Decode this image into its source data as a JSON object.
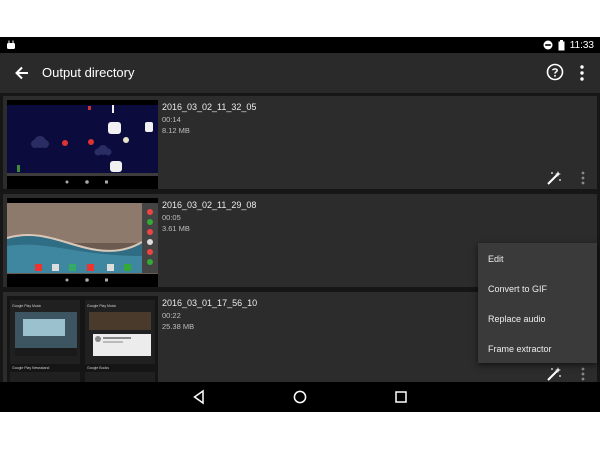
{
  "status_bar": {
    "time": "11:33",
    "icons": [
      "android-icon",
      "do-not-disturb-icon",
      "battery-icon"
    ]
  },
  "app_bar": {
    "title": "Output directory",
    "icons": [
      "back-arrow-icon",
      "help-icon",
      "overflow-menu-icon"
    ]
  },
  "videos": [
    {
      "name": "2016_03_02_11_32_05",
      "duration": "00:14",
      "size": "8.12 MB"
    },
    {
      "name": "2016_03_02_11_29_08",
      "duration": "00:05",
      "size": "3.61 MB"
    },
    {
      "name": "2016_03_01_17_56_10",
      "duration": "00:22",
      "size": "25.38 MB"
    }
  ],
  "thumb_text": {
    "col1_label": "Google Play Music",
    "col2_label": "Google Play Music",
    "col1_label_2": "Google Play Newsstand",
    "col2_label_2": "Google Books"
  },
  "context_menu": {
    "items": [
      "Edit",
      "Convert to GIF",
      "Replace audio",
      "Frame extractor"
    ]
  },
  "nav_bar": {
    "icons": [
      "back-triangle-icon",
      "home-circle-icon",
      "recents-square-icon"
    ]
  },
  "colors": {
    "background": "#1f1f1f",
    "app_bar": "#2a2a2a",
    "card": "#2c2c2c",
    "menu": "#3a3a3a"
  }
}
